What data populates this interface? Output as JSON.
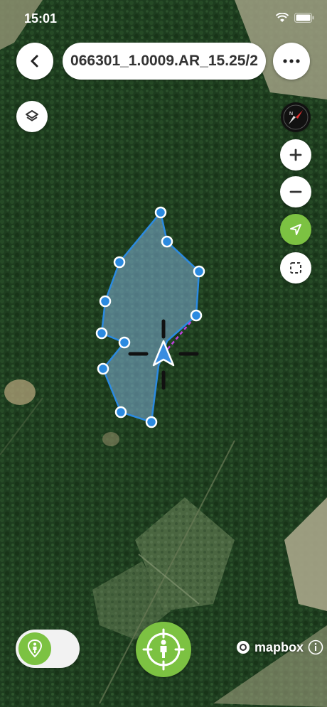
{
  "status_bar": {
    "time": "15:01"
  },
  "header": {
    "title": "066301_1.0009.AR_15.25/2"
  },
  "icons": {
    "back": "chevron-left-icon",
    "more": "ellipsis-icon",
    "layers": "layers-icon",
    "compass": "compass-icon",
    "zoom_in": "plus-icon",
    "zoom_out": "minus-icon",
    "locate": "location-arrow-icon",
    "select": "dashed-square-icon",
    "walk_mode": "person-pin-icon",
    "record": "person-target-icon",
    "info": "info-icon"
  },
  "colors": {
    "accent_green": "#7cc242",
    "polygon_stroke": "#2b8ae0",
    "polygon_fill": "#7fb0d8",
    "guide_line": "#c040e0",
    "user_arrow": "#3a8de0"
  },
  "map": {
    "attribution": "mapbox"
  },
  "walk_toggle": {
    "on": true
  }
}
